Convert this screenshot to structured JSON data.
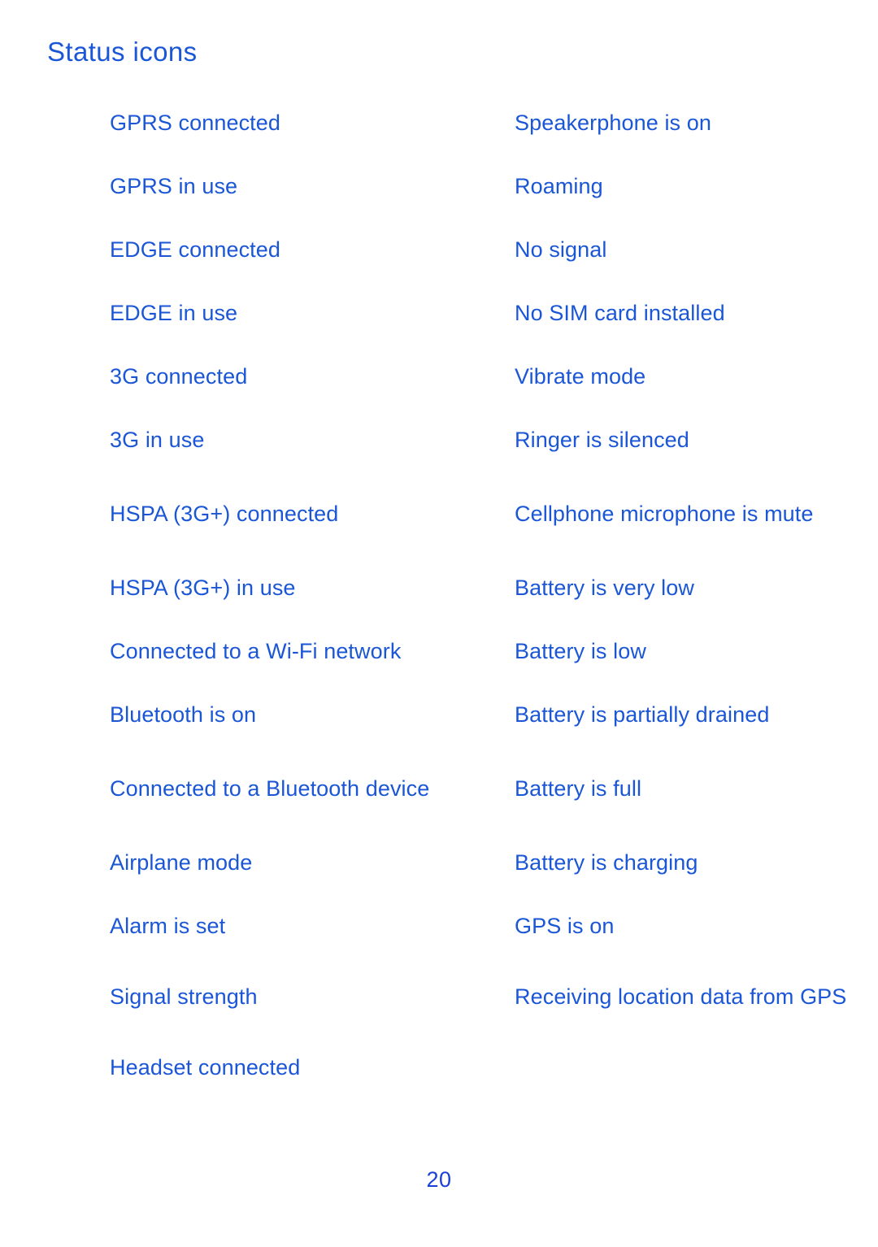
{
  "document": {
    "title": "Status icons",
    "page_number": "20",
    "text_color": "#1a56d6"
  },
  "rows": [
    {
      "left": "GPRS connected",
      "right": "Speakerphone is on"
    },
    {
      "left": "GPRS in use",
      "right": "Roaming"
    },
    {
      "left": "EDGE connected",
      "right": "No signal"
    },
    {
      "left": "EDGE in use",
      "right": "No SIM card installed"
    },
    {
      "left": "3G connected",
      "right": "Vibrate mode"
    },
    {
      "left": "3G in use",
      "right": "Ringer is silenced"
    },
    {
      "left": "HSPA (3G+) connected",
      "right": "Cellphone microphone is mute"
    },
    {
      "left": "HSPA (3G+) in use",
      "right": "Battery is very low"
    },
    {
      "left": "Connected to a Wi-Fi network",
      "right": "Battery is low"
    },
    {
      "left": "Bluetooth is on",
      "right": "Battery is partially drained"
    },
    {
      "left": "Connected to a Bluetooth device",
      "right": "Battery is full"
    },
    {
      "left": "Airplane mode",
      "right": "Battery is charging"
    },
    {
      "left": "Alarm is set",
      "right": "GPS is on"
    },
    {
      "left": "Signal strength",
      "right": "Receiving location data from GPS"
    },
    {
      "left": "Headset connected",
      "right": ""
    }
  ]
}
